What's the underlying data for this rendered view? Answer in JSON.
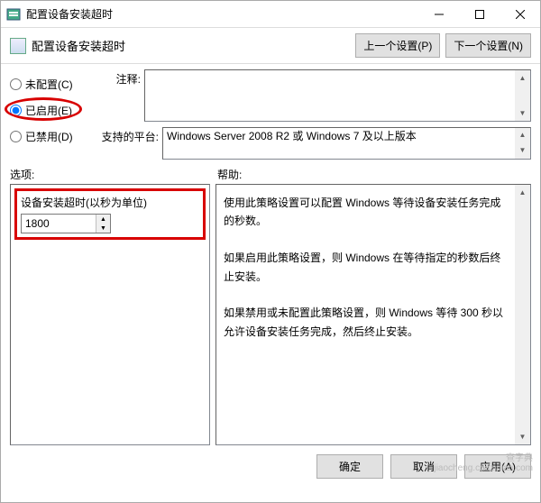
{
  "window": {
    "title": "配置设备安装超时"
  },
  "header": {
    "title": "配置设备安装超时",
    "prev_btn": "上一个设置(P)",
    "next_btn": "下一个设置(N)"
  },
  "radios": {
    "not_configured": "未配置(C)",
    "enabled": "已启用(E)",
    "disabled": "已禁用(D)",
    "selected": "enabled"
  },
  "fields": {
    "comment_label": "注释:",
    "comment_value": "",
    "platform_label": "支持的平台:",
    "platform_value": "Windows Server 2008 R2 或 Windows 7 及以上版本"
  },
  "sections": {
    "options_label": "选项:",
    "help_label": "帮助:"
  },
  "option": {
    "label": "设备安装超时(以秒为单位)",
    "value": "1800"
  },
  "help": {
    "p1": "使用此策略设置可以配置 Windows 等待设备安装任务完成的秒数。",
    "p2": "如果启用此策略设置，则 Windows 在等待指定的秒数后终止安装。",
    "p3": "如果禁用或未配置此策略设置，则 Windows 等待 300 秒以允许设备安装任务完成，然后终止安装。"
  },
  "buttons": {
    "ok": "确定",
    "cancel": "取消",
    "apply": "应用(A)"
  },
  "watermark": {
    "l1": "查字典",
    "l2": "jiaocheng.chazidian.com"
  }
}
